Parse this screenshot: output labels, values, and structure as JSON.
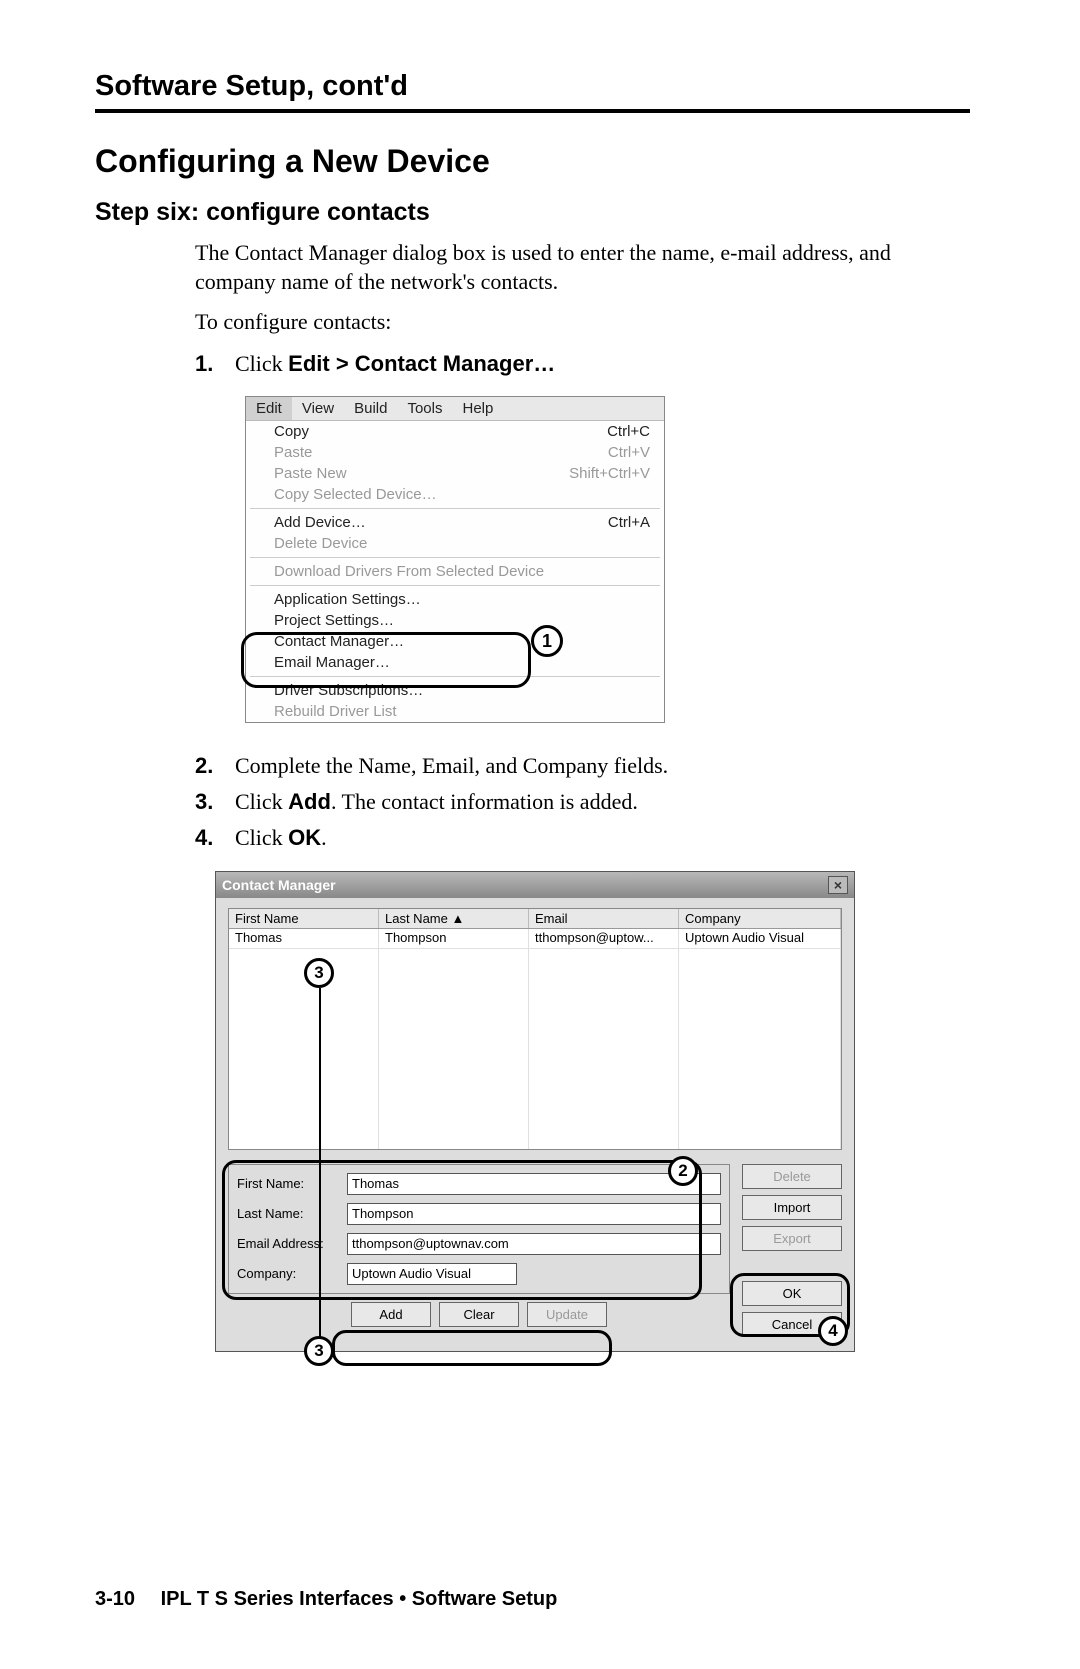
{
  "section_header": "Software Setup, cont'd",
  "main_heading": "Configuring a New Device",
  "step_heading": "Step six: configure contacts",
  "intro1": "The Contact Manager dialog box is used to enter the name, e-mail address, and company name of the network's contacts.",
  "intro2": "To configure contacts:",
  "steps": {
    "s1_num": "1.",
    "s1_a": "Click ",
    "s1_b": "Edit > Contact Manager…",
    "s2_num": "2.",
    "s2": "Complete the Name, Email, and Company fields.",
    "s3_num": "3.",
    "s3_a": "Click ",
    "s3_b": "Add",
    "s3_c": ".  The contact information is added.",
    "s4_num": "4.",
    "s4_a": "Click ",
    "s4_b": "OK",
    "s4_c": "."
  },
  "menu": {
    "bar": {
      "edit": "Edit",
      "view": "View",
      "build": "Build",
      "tools": "Tools",
      "help": "Help"
    },
    "items": {
      "copy": "Copy",
      "copy_k": "Ctrl+C",
      "paste": "Paste",
      "paste_k": "Ctrl+V",
      "paste_new": "Paste New",
      "paste_new_k": "Shift+Ctrl+V",
      "copy_sel": "Copy Selected Device…",
      "add_dev": "Add Device…",
      "add_dev_k": "Ctrl+A",
      "del_dev": "Delete Device",
      "dl_drv": "Download Drivers From Selected Device",
      "app_set": "Application Settings…",
      "proj_set": "Project Settings…",
      "contact": "Contact Manager…",
      "email": "Email Manager…",
      "drv_sub": "Driver Subscriptions…",
      "rebuild": "Rebuild Driver List"
    },
    "callout": "1"
  },
  "dialog": {
    "title": "Contact Manager",
    "close": "×",
    "headers": {
      "fn": "First Name",
      "ln": "Last Name",
      "em": "Email",
      "co": "Company"
    },
    "sort": "▲",
    "row": {
      "fn": "Thomas",
      "ln": "Thompson",
      "em": "tthompson@uptow...",
      "co": "Uptown Audio Visual"
    },
    "labels": {
      "fn": "First Name:",
      "ln": "Last Name:",
      "em": "Email Address:",
      "co": "Company:"
    },
    "fields": {
      "fn": "Thomas",
      "ln": "Thompson",
      "em": "tthompson@uptownav.com",
      "co": "Uptown Audio Visual"
    },
    "buttons": {
      "delete": "Delete",
      "import": "Import",
      "export": "Export",
      "add": "Add",
      "clear": "Clear",
      "update": "Update",
      "ok": "OK",
      "cancel": "Cancel"
    },
    "callouts": {
      "c2": "2",
      "c3": "3",
      "c4": "4"
    }
  },
  "footer": {
    "page": "3-10",
    "text": "IPL T S Series Interfaces • Software Setup"
  }
}
